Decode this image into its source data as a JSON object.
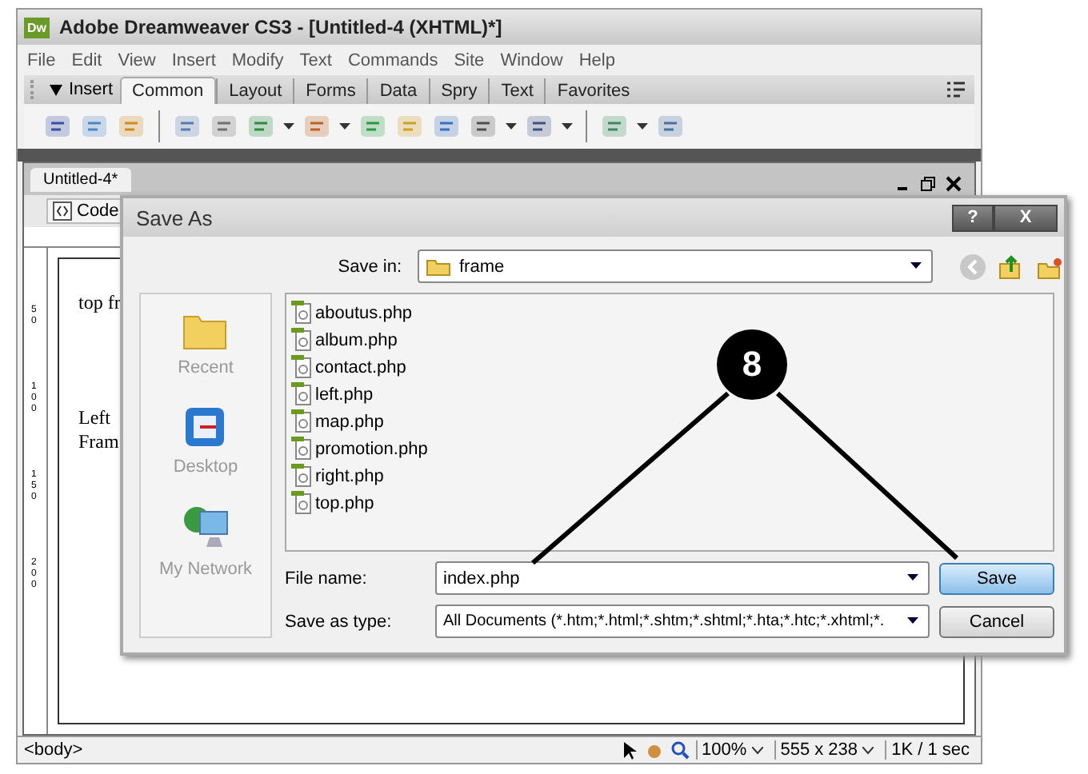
{
  "window": {
    "app_badge": "Dw",
    "title": "Adobe Dreamweaver CS3 - [Untitled-4 (XHTML)*]"
  },
  "menu": [
    "File",
    "Edit",
    "View",
    "Insert",
    "Modify",
    "Text",
    "Commands",
    "Site",
    "Window",
    "Help"
  ],
  "insert_bar": {
    "label": "Insert",
    "tabs": [
      {
        "label": "Common",
        "selected": true
      },
      {
        "label": "Layout",
        "selected": false
      },
      {
        "label": "Forms",
        "selected": false
      },
      {
        "label": "Data",
        "selected": false
      },
      {
        "label": "Spry",
        "selected": false
      },
      {
        "label": "Text",
        "selected": false
      },
      {
        "label": "Favorites",
        "selected": false
      }
    ]
  },
  "document": {
    "tab": "Untitled-4*",
    "view_button": "Code",
    "ruler_marks": [
      "50",
      "100",
      "150",
      "200"
    ],
    "lines": [
      "top fr",
      "Left",
      "Fram"
    ]
  },
  "status_bar": {
    "tag": "<body>",
    "zoom": "100%",
    "size": "555 x 238",
    "download": "1K / 1 sec"
  },
  "dialog": {
    "title": "Save As",
    "help": "?",
    "close": "X",
    "save_in_label": "Save in:",
    "save_in": "frame",
    "places": [
      {
        "label": "Recent",
        "kind": "recent"
      },
      {
        "label": "Desktop",
        "kind": "desktop"
      },
      {
        "label": "My Network",
        "kind": "network"
      }
    ],
    "files": [
      "aboutus.php",
      "album.php",
      "contact.php",
      "left.php",
      "map.php",
      "promotion.php",
      "right.php",
      "top.php"
    ],
    "file_name_label": "File name:",
    "file_name": "index.php",
    "type_label": "Save as type:",
    "type": "All Documents (*.htm;*.html;*.shtm;*.shtml;*.hta;*.htc;*.xhtml;*.",
    "buttons": [
      {
        "label": "Save",
        "default": true
      },
      {
        "label": "Cancel",
        "default": false
      }
    ]
  },
  "callout": {
    "number": "8"
  }
}
